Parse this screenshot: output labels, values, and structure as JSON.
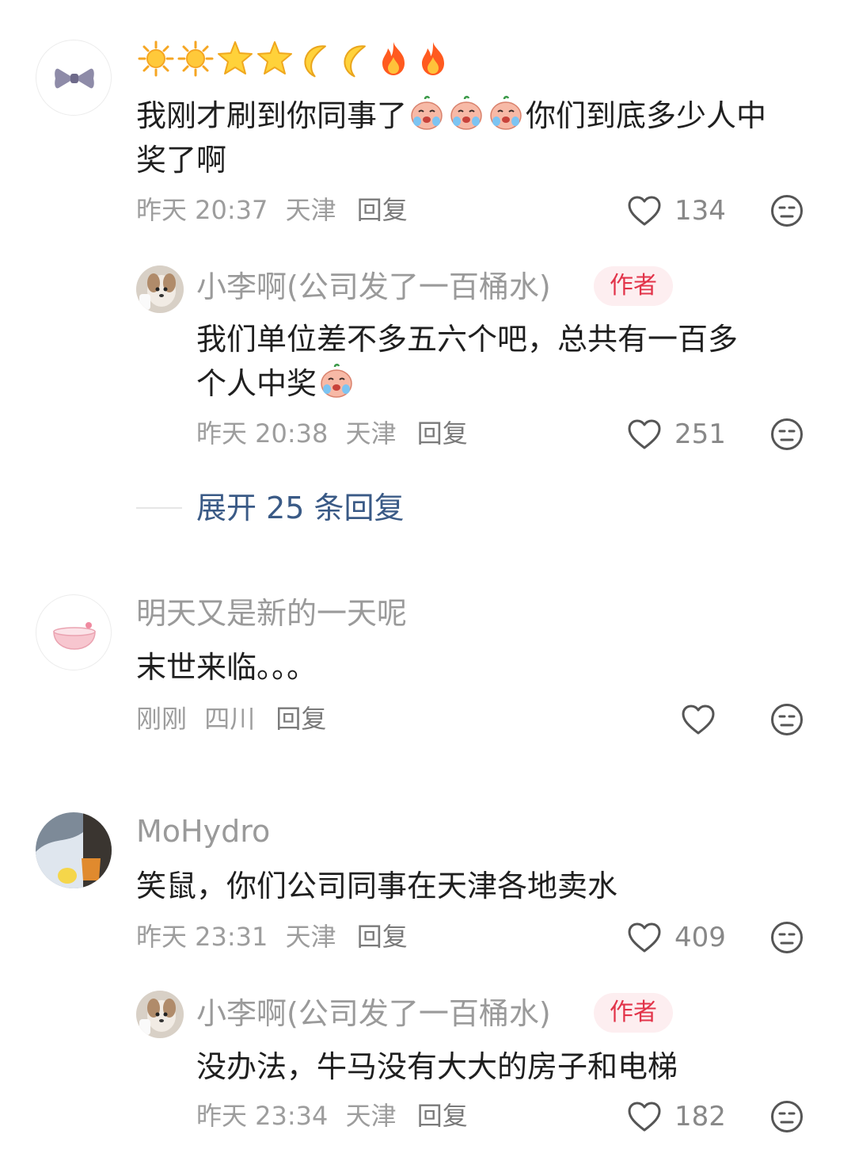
{
  "comments": [
    {
      "name_icons": [
        "sun-icon",
        "sun-icon",
        "star-icon",
        "star-icon",
        "moon-icon",
        "moon-icon",
        "fire-icon",
        "fire-icon"
      ],
      "content_line1_a": "我刚才刷到你同事了",
      "content_line1_b": "你们到底多少人中",
      "content_line2": "奖了啊",
      "time": "昨天 20:37",
      "location": "天津",
      "reply_label": "回复",
      "likes": "134",
      "replies": [
        {
          "name": "小李啊(公司发了一百桶水)",
          "badge": "作者",
          "content_line1": "我们单位差不多五六个吧，总共有一百多",
          "content_line2": "个人中奖",
          "time": "昨天 20:38",
          "location": "天津",
          "reply_label": "回复",
          "likes": "251"
        }
      ],
      "expand_label": "展开 25 条回复"
    },
    {
      "name": "明天又是新的一天呢",
      "content": "末世来临。。。",
      "time": "刚刚",
      "location": "四川",
      "reply_label": "回复",
      "likes": ""
    },
    {
      "name": "MoHydro",
      "content": "笑鼠，你们公司同事在天津各地卖水",
      "time": "昨天 23:31",
      "location": "天津",
      "reply_label": "回复",
      "likes": "409",
      "replies": [
        {
          "name": "小李啊(公司发了一百桶水)",
          "badge": "作者",
          "content": "没办法，牛马没有大大的房子和电梯",
          "time": "昨天 23:34",
          "location": "天津",
          "reply_label": "回复",
          "likes": "182"
        }
      ]
    }
  ],
  "colors": {
    "badge_bg": "#fdeef0",
    "badge_text": "#e2344a",
    "expand_text": "#3a5a86",
    "meta_text": "#9d9d9d"
  }
}
